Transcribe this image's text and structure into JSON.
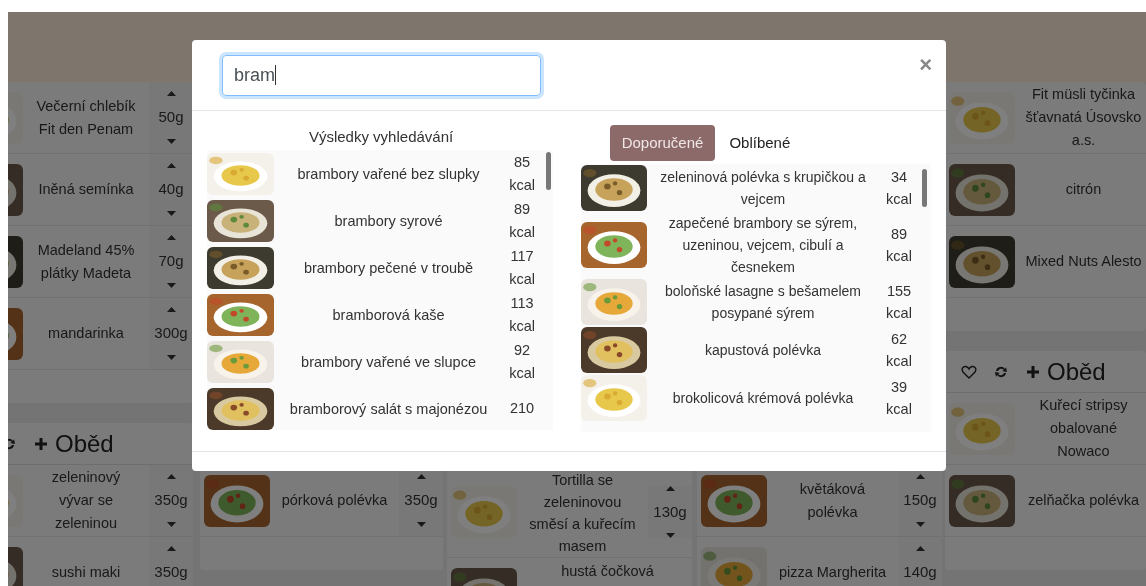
{
  "search": {
    "value": "bram"
  },
  "close_label": "×",
  "results": {
    "title": "Výsledky vyhledávání",
    "items": [
      {
        "name": "brambory vařené bez slupky",
        "kcal": "85 kcal"
      },
      {
        "name": "brambory syrové",
        "kcal": "89 kcal"
      },
      {
        "name": "brambory pečené v troubě",
        "kcal": "117 kcal"
      },
      {
        "name": "bramborová kaše",
        "kcal": "113 kcal"
      },
      {
        "name": "brambory vařené ve slupce",
        "kcal": "92 kcal"
      },
      {
        "name": "bramborový salát s majonézou",
        "kcal": "210"
      }
    ]
  },
  "tabs": [
    {
      "label": "Doporučené",
      "selected": true
    },
    {
      "label": "Oblíbené",
      "selected": false
    }
  ],
  "recommended": [
    {
      "name": "zeleninová polévka s krupičkou a vejcem",
      "kcal": "34 kcal"
    },
    {
      "name": "zapečené brambory se sýrem, uzeninou, vejcem, cibulí a česnekem",
      "kcal": "89 kcal"
    },
    {
      "name": "boloňské lasagne s bešamelem posypané sýrem",
      "kcal": "155 kcal"
    },
    {
      "name": "kapustová polévka",
      "kcal": "62 kcal"
    },
    {
      "name": "brokolicová krémová polévka",
      "kcal": "39 kcal"
    }
  ],
  "background": {
    "columns": [
      {
        "sections": [
          {
            "items": [
              {
                "name": "Večerní chlebík Fit den Penam",
                "weight": "50g"
              },
              {
                "name": "Iněná semínka",
                "weight": "40g"
              },
              {
                "name": "Madeland 45% plátky Madeta",
                "weight": "70g"
              },
              {
                "name": "mandarinka",
                "weight": "300g"
              }
            ]
          },
          {
            "title": "Oběd",
            "items": [
              {
                "name": "zeleninový vývar se zeleninou",
                "weight": "350g"
              },
              {
                "name": "sushi maki",
                "weight": "350g"
              }
            ]
          }
        ]
      },
      {
        "sections": [
          {
            "items": [
              {
                "name": "pórková polévka",
                "weight": "350g"
              }
            ]
          }
        ]
      },
      {
        "sections": [
          {
            "items": [
              {
                "name": "Tortilla se zeleninovou směsí a kuřecím masem",
                "weight": "130g"
              },
              {
                "name": "hustá čočková"
              }
            ]
          }
        ]
      },
      {
        "sections": [
          {
            "items": [
              {
                "name": "květáková polévka",
                "weight": "150g"
              },
              {
                "name": "pizza Margherita",
                "weight": "140g"
              }
            ]
          }
        ]
      },
      {
        "sections": [
          {
            "items": [
              {
                "name": "Fit müsli tyčinka šťavnatá Úsovsko a.s."
              },
              {
                "name": "citrón"
              },
              {
                "name": "Mixed Nuts Alesto"
              }
            ]
          },
          {
            "title": "Oběd",
            "items": [
              {
                "name": "Kuřecí stripsy obalované Nowaco"
              },
              {
                "name": "zelňačka polévka"
              }
            ]
          }
        ]
      }
    ]
  }
}
